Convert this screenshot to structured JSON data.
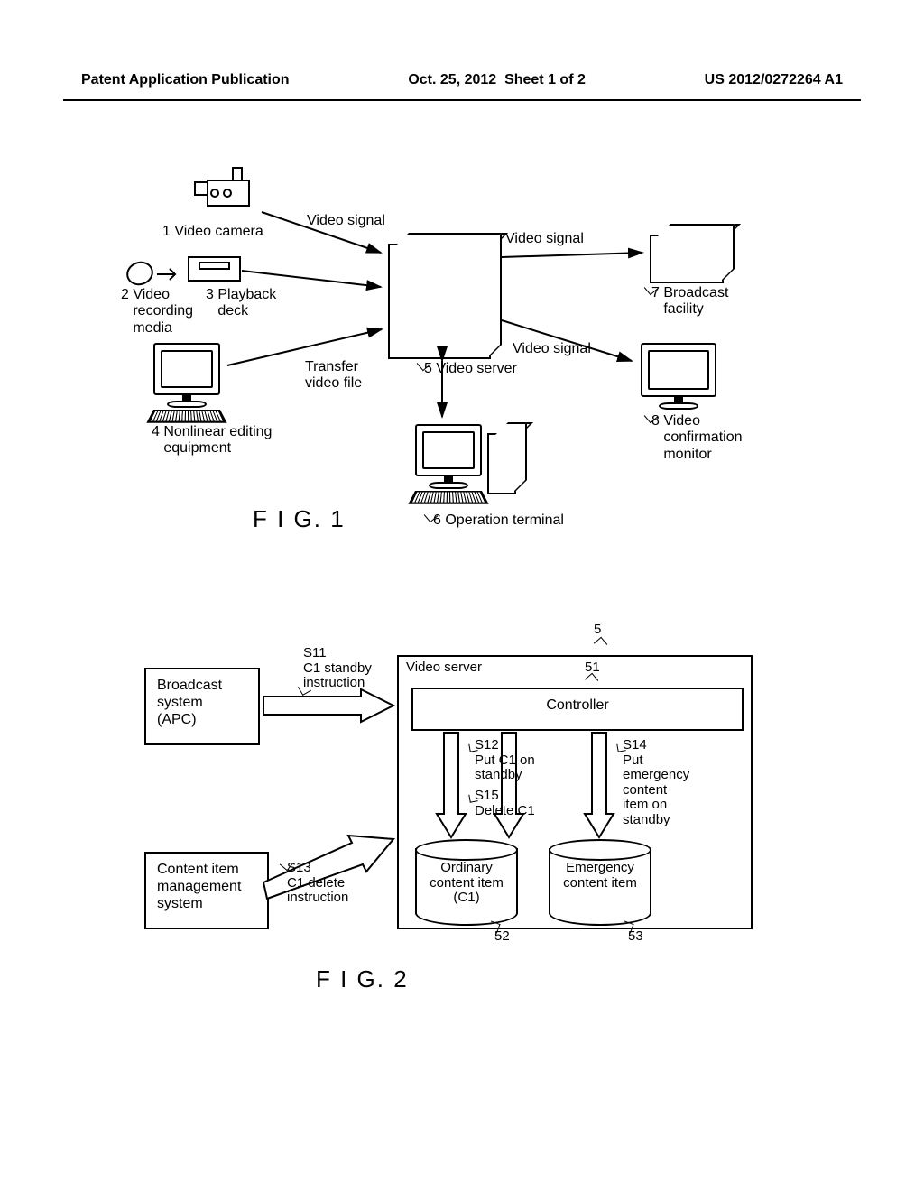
{
  "header": {
    "left": "Patent Application Publication",
    "center": "Oct. 25, 2012  Sheet 1 of 2",
    "right": "US 2012/0272264 A1"
  },
  "fig1": {
    "caption": "F I G. 1",
    "nodes": {
      "camera": "1 Video camera",
      "media": "2 Video\n   recording\n   media",
      "deck": "3 Playback\n   deck",
      "nle": "4 Nonlinear editing\n   equipment",
      "server": "5 Video server",
      "op_terminal": "6 Operation terminal",
      "broadcast": "7 Broadcast\n   facility",
      "monitor": "8 Video\n   confirmation\n   monitor"
    },
    "edges": {
      "vs1": "Video signal",
      "vs2": "Video signal",
      "vs3": "Video signal",
      "transfer": "Transfer\nvideo file"
    }
  },
  "fig2": {
    "caption": "F I G. 2",
    "apc": "Broadcast\nsystem\n(APC)",
    "cms": "Content item\nmanagement\nsystem",
    "server_label": "Video server",
    "server_ref": "5",
    "controller": "Controller",
    "controller_ref": "51",
    "cyl_ord": "Ordinary\ncontent item\n(C1)",
    "cyl_ord_ref": "52",
    "cyl_emg": "Emergency\ncontent item",
    "cyl_emg_ref": "53",
    "s11": "S11\nC1 standby\ninstruction",
    "s12": "S12\nPut C1 on\nstandby",
    "s13": "S13\nC1 delete\ninstruction",
    "s14": "S14\nPut\nemergency\ncontent\nitem on\nstandby",
    "s15": "S15\nDelete C1"
  }
}
